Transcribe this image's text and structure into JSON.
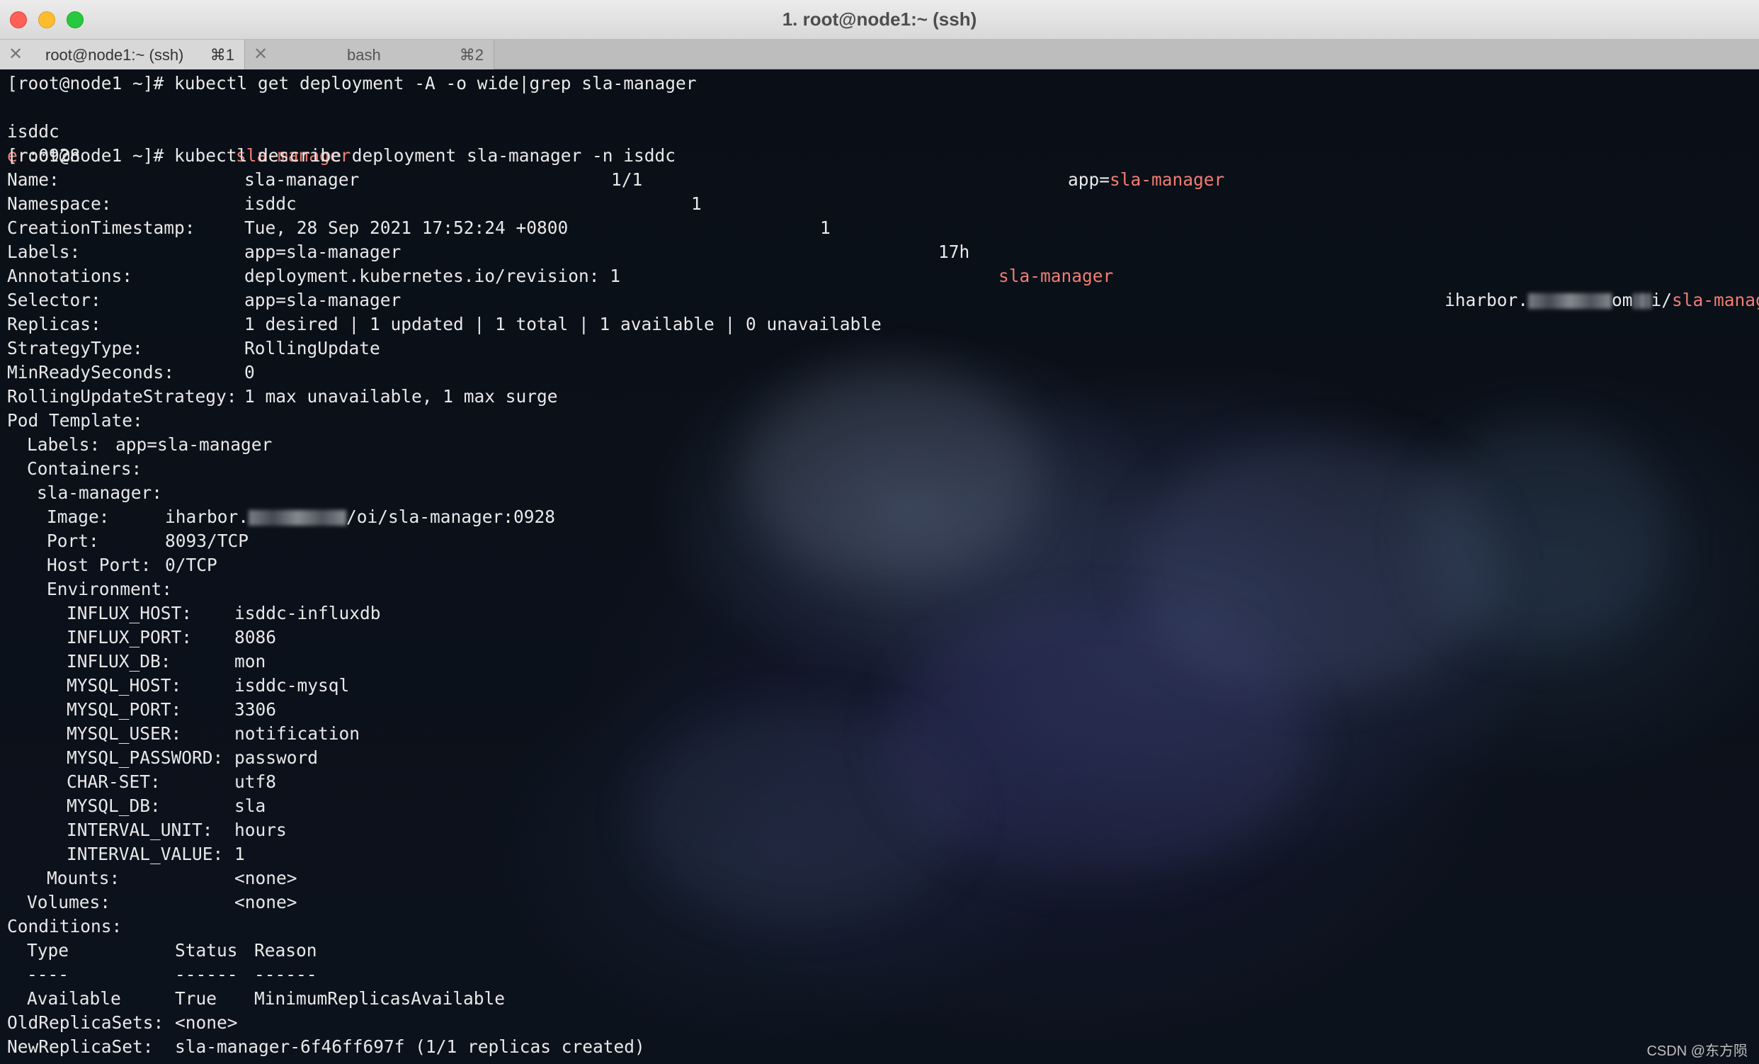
{
  "window": {
    "title": "1. root@node1:~ (ssh)"
  },
  "tabs": [
    {
      "label": "root@node1:~ (ssh)",
      "shortcut": "⌘1",
      "active": true
    },
    {
      "label": "bash",
      "shortcut": "⌘2",
      "active": false
    }
  ],
  "colors": {
    "highlight": "#f07d73",
    "text": "#e8e8e8",
    "background": "#0b1018"
  },
  "terminal": {
    "cmd1": "[root@node1 ~]# kubectl get deployment -A -o wide|grep sla-manager",
    "row": {
      "namespace": "isddc",
      "name": "sla-manager",
      "ready": "1/1",
      "uptodate": "1",
      "available": "1",
      "age": "17h",
      "containers": "sla-manager",
      "image_prefix": "iharbor.",
      "image_mid": "om",
      "image_slash": "i/",
      "image_name_part": "sla-manag",
      "image_wrap_part": "er",
      "image_tag": ":0928",
      "selector_prefix": "app=",
      "selector_value": "sla-manager"
    },
    "cmd2": "[root@node1 ~]# kubectl describe deployment sla-manager -n isddc",
    "fields": [
      {
        "key": "Name:",
        "value": "sla-manager"
      },
      {
        "key": "Namespace:",
        "value": "isddc"
      },
      {
        "key": "CreationTimestamp:",
        "value": "Tue, 28 Sep 2021 17:52:24 +0800"
      },
      {
        "key": "Labels:",
        "value": "app=sla-manager"
      },
      {
        "key": "Annotations:",
        "value": "deployment.kubernetes.io/revision: 1"
      },
      {
        "key": "Selector:",
        "value": "app=sla-manager"
      },
      {
        "key": "Replicas:",
        "value": "1 desired | 1 updated | 1 total | 1 available | 0 unavailable"
      },
      {
        "key": "StrategyType:",
        "value": "RollingUpdate"
      },
      {
        "key": "MinReadySeconds:",
        "value": "0"
      },
      {
        "key": "RollingUpdateStrategy:",
        "value": "1 max unavailable, 1 max surge"
      }
    ],
    "pod_template": "Pod Template:",
    "pod_labels_key": "Labels:",
    "pod_labels_value": "app=sla-manager",
    "containers_key": "Containers:",
    "container_name": "sla-manager:",
    "image_key": "Image:",
    "image_prefix": "iharbor.",
    "image_suffix": "/oi/sla-manager:0928",
    "port_key": "Port:",
    "port_value": "8093/TCP",
    "hostport_key": "Host Port:",
    "hostport_value": "0/TCP",
    "environment_key": "Environment:",
    "env": [
      {
        "key": "INFLUX_HOST:",
        "value": "isddc-influxdb"
      },
      {
        "key": "INFLUX_PORT:",
        "value": "8086"
      },
      {
        "key": "INFLUX_DB:",
        "value": "mon"
      },
      {
        "key": "MYSQL_HOST:",
        "value": "isddc-mysql"
      },
      {
        "key": "MYSQL_PORT:",
        "value": "3306"
      },
      {
        "key": "MYSQL_USER:",
        "value": "notification"
      },
      {
        "key": "MYSQL_PASSWORD:",
        "value": "password"
      },
      {
        "key": "CHAR-SET:",
        "value": "utf8"
      },
      {
        "key": "MYSQL_DB:",
        "value": "sla"
      },
      {
        "key": "INTERVAL_UNIT:",
        "value": "hours"
      },
      {
        "key": "INTERVAL_VALUE:",
        "value": "1"
      }
    ],
    "mounts_key": "Mounts:",
    "mounts_value": "<none>",
    "volumes_key": "Volumes:",
    "volumes_value": "<none>",
    "conditions_key": "Conditions:",
    "conditions_header": {
      "type": "Type",
      "status": "Status",
      "reason": "Reason"
    },
    "conditions_sep": {
      "type": "----",
      "status": "------",
      "reason": "------"
    },
    "conditions_row": {
      "type": "Available",
      "status": "True",
      "reason": "MinimumReplicasAvailable"
    },
    "old_rs_key": "OldReplicaSets:",
    "old_rs_value": "<none>",
    "new_rs_key": "NewReplicaSet:",
    "new_rs_value": "sla-manager-6f46ff697f (1/1 replicas created)"
  },
  "watermark": "CSDN @东方陨"
}
